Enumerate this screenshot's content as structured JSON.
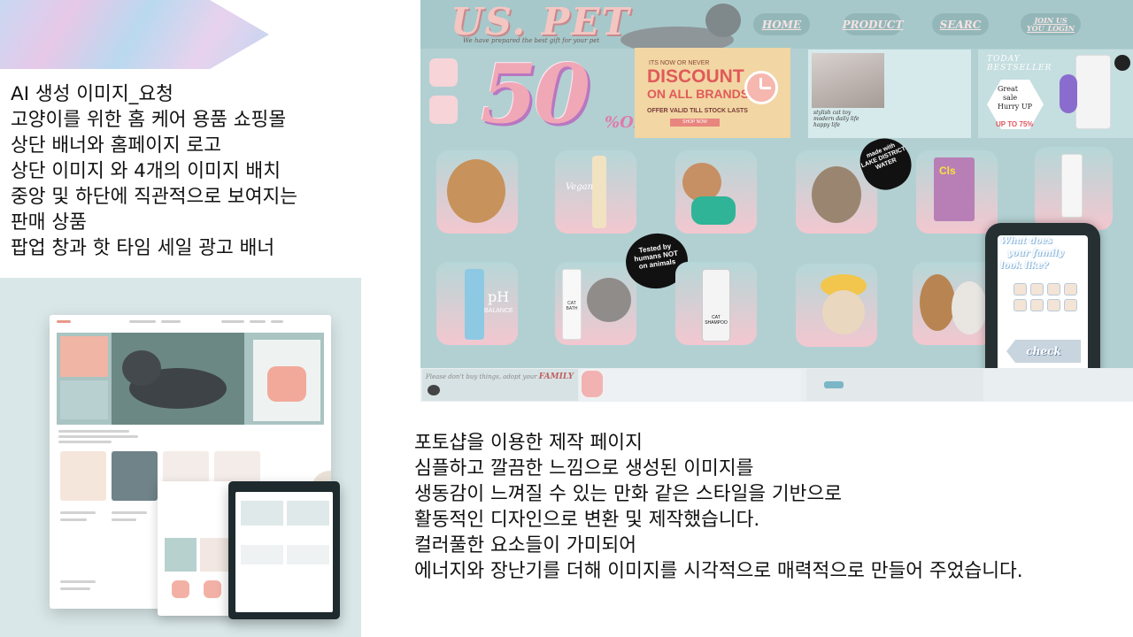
{
  "slide": {
    "top_text_lines": [
      "AI 생성 이미지_요청",
      "고양이를 위한 홈 케어 용품 쇼핑몰",
      "상단 배너와 홈페이지 로고",
      "상단 이미지 와 4개의 이미지 배치",
      "중앙 및 하단에 직관적으로 보여지는",
      "판매 상품",
      "팝업 창과 핫 타임 세일 광고 배너"
    ],
    "bottom_text_lines": [
      "포토샵을 이용한 제작 페이지",
      "심플하고 깔끔한 느낌으로 생성된 이미지를",
      "생동감이 느껴질 수 있는 만화 같은 스타일을 기반으로",
      "활동적인 디자인으로 변환 및 제작했습니다.",
      "컬러풀한 요소들이 가미되어",
      "에너지와 장난기를 더해 이미지를 시각적으로 매력적으로 만들어 주었습니다."
    ]
  },
  "site": {
    "logo": "US. PET",
    "tagline": "We have prepared the best gift for your pet",
    "nav": {
      "home": "HOME",
      "product": "PRODUCT",
      "search": "SEARC",
      "join_line1": "JOIN US",
      "join_line2": "YOU_LOGIN"
    },
    "sale": {
      "big_number": "50",
      "percent_off": "%OFF"
    },
    "discount": {
      "top": "ITS NOW OR NEVER",
      "headline_line1": "DISCOUNT",
      "headline_line2": "ON ALL BRANDS!",
      "sub": "OFFER VALID TILL STOCK LASTS",
      "button": "SHOP NOW"
    },
    "photo_caption": "stylish cat toy\nmodern daily life\nhappy life",
    "bestseller": {
      "title_line1": "TODAY",
      "title_line2": "BESTSELLER",
      "great": "Great",
      "sale": "sale",
      "hurry": "Hurry UP",
      "upto": "UP TO 75%"
    },
    "badges": {
      "tested_line1": "Tested by",
      "tested_line2": "humans NOT",
      "tested_line3": "on animals",
      "lake_line1": "made with",
      "lake_line2": "LAKE DISTRICT",
      "lake_line3": "WATER"
    },
    "product_labels": {
      "vegan": "Vegan",
      "ph": "pH",
      "balance": "BALANCE",
      "cat_bath": "CAT BATH",
      "cats_litter": "Cls",
      "cat_shampoo": "CAT SHAMPOO"
    },
    "popup": {
      "question_line1": "What does",
      "question_line2": "your family",
      "question_line3": "look like?",
      "check": "check"
    },
    "footer": {
      "text": "Please don't buy things, adopt your",
      "family": "FAMILY"
    }
  },
  "colors": {
    "site_bg": "#b2d0d2",
    "logo_pink": "#f4c6c2",
    "discount_red": "#e05a5a",
    "tile_gradient_top": "#b6d7d8",
    "tile_gradient_bottom": "#f3c7cf"
  }
}
